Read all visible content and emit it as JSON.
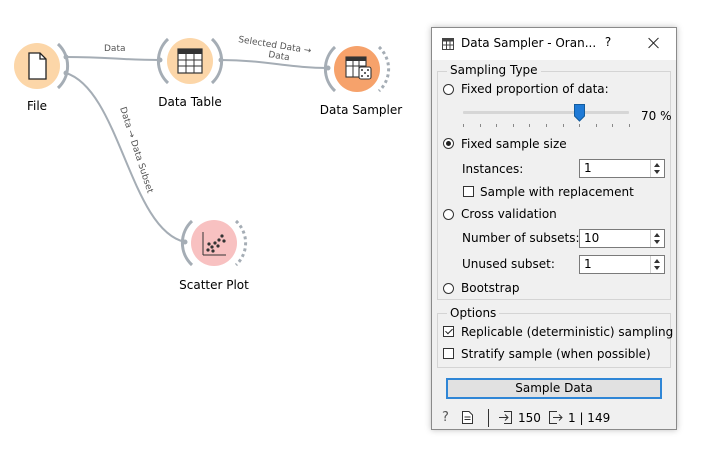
{
  "canvas": {
    "nodes": {
      "file": "File",
      "data_table": "Data Table",
      "data_sampler": "Data Sampler",
      "scatter_plot": "Scatter Plot"
    },
    "links": {
      "file_to_table": "Data",
      "table_to_sampler_1": "Selected Data →",
      "table_to_sampler_2": "Data",
      "file_to_scatter": "Data → Data Subset"
    },
    "colors": {
      "file_node": "#fcd6a8",
      "sampler_node": "#f6a26b",
      "scatter_node": "#f8c1c1",
      "link": "#a5adb5"
    }
  },
  "dialog": {
    "title": "Data Sampler - Oran...",
    "help": "?",
    "sampling_type": {
      "title": "Sampling Type",
      "fixed_proportion": "Fixed proportion of data:",
      "proportion_value": 70,
      "proportion_label": "70 %",
      "fixed_sample_size": "Fixed sample size",
      "instances_label": "Instances:",
      "instances_value": "1",
      "replacement": "Sample with replacement",
      "cross_validation": "Cross validation",
      "subsets_label": "Number of subsets:",
      "subsets_value": "10",
      "unused_label": "Unused subset:",
      "unused_value": "1",
      "bootstrap": "Bootstrap",
      "selected": "fixed_sample_size"
    },
    "options": {
      "title": "Options",
      "replicable": "Replicable (deterministic) sampling",
      "replicable_checked": true,
      "stratify": "Stratify sample (when possible)",
      "stratify_checked": false
    },
    "sample_button": "Sample Data",
    "status": {
      "input_count": "150",
      "output_count": "1 | 149"
    },
    "accent_color": "#2f86d6"
  }
}
